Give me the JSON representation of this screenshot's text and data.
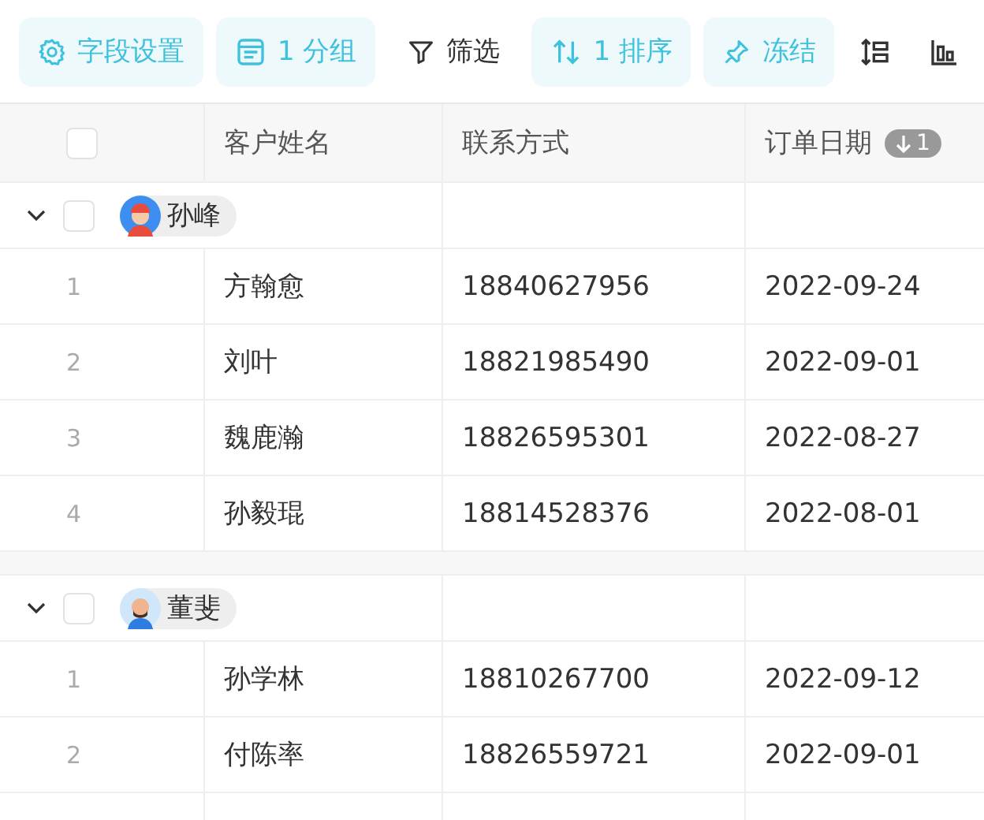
{
  "toolbar": [
    {
      "kind": "gear",
      "label": "字段设置",
      "active": true
    },
    {
      "kind": "group",
      "label": "1 分组",
      "active": true
    },
    {
      "kind": "filter",
      "label": "筛选",
      "active": false
    },
    {
      "kind": "sort",
      "label": "1 排序",
      "active": true
    },
    {
      "kind": "pin",
      "label": "冻结",
      "active": true
    },
    {
      "kind": "row-height",
      "active": false
    },
    {
      "kind": "chart",
      "active": false
    }
  ],
  "table": {
    "select_all_checked": false,
    "columns": [
      {
        "label": "客户姓名"
      },
      {
        "label": "联系方式"
      },
      {
        "label": "订单日期",
        "sort_badge": "1"
      }
    ],
    "groups": [
      {
        "name": "孙峰",
        "avatar": {
          "kind": "cap"
        },
        "expanded": true,
        "checked": false,
        "rows": [
          {
            "index": "1",
            "cells": [
              "方翰愈",
              "18840627956",
              "2022-09-24"
            ]
          },
          {
            "index": "2",
            "cells": [
              "刘叶",
              "18821985490",
              "2022-09-01"
            ]
          },
          {
            "index": "3",
            "cells": [
              "魏鹿瀚",
              "18826595301",
              "2022-08-27"
            ]
          },
          {
            "index": "4",
            "cells": [
              "孙毅琨",
              "18814528376",
              "2022-08-01"
            ]
          }
        ]
      },
      {
        "name": "董斐",
        "avatar": {
          "kind": "bald"
        },
        "expanded": true,
        "checked": false,
        "rows": [
          {
            "index": "1",
            "cells": [
              "孙学林",
              "18810267700",
              "2022-09-12"
            ]
          },
          {
            "index": "2",
            "cells": [
              "付陈率",
              "18826559721",
              "2022-09-01"
            ]
          }
        ]
      }
    ]
  }
}
